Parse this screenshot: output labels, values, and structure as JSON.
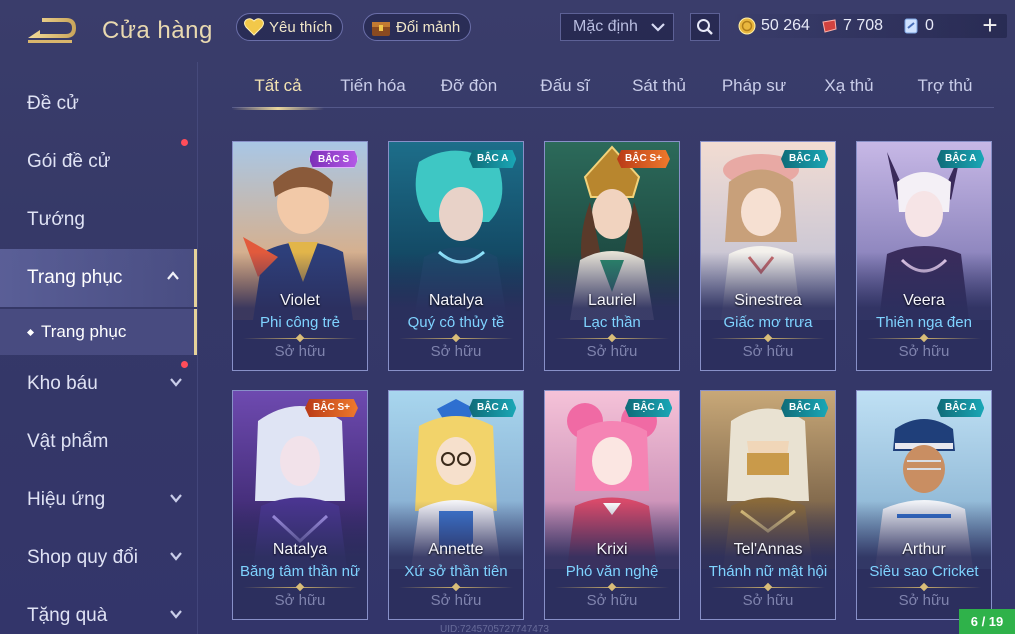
{
  "header": {
    "title": "Cửa hàng",
    "favorites_label": "Yêu thích",
    "exchange_label": "Đổi mảnh",
    "sort_value": "Mặc định",
    "currencies": [
      {
        "icon": "gold-coin-icon",
        "value": "50 264"
      },
      {
        "icon": "ruby-icon",
        "value": "7 708"
      },
      {
        "icon": "voucher-icon",
        "value": "0"
      }
    ],
    "plus_label": "+"
  },
  "sidebar": {
    "items": [
      {
        "label": "Đề cử"
      },
      {
        "label": "Gói đề cử"
      },
      {
        "label": "Tướng"
      },
      {
        "label": "Trang phục"
      },
      {
        "label": "Kho báu"
      },
      {
        "label": "Vật phẩm"
      },
      {
        "label": "Hiệu ứng"
      },
      {
        "label": "Shop quy đổi"
      },
      {
        "label": "Tặng quà"
      }
    ],
    "sub_item": "Trang phục"
  },
  "tabs": [
    "Tất cả",
    "Tiến hóa",
    "Đỡ đòn",
    "Đấu sĩ",
    "Sát thủ",
    "Pháp sư",
    "Xạ thủ",
    "Trợ thủ"
  ],
  "cards": [
    {
      "hero": "Violet",
      "skin": "Phi công trẻ",
      "status": "Sở hữu",
      "tier": "BẬC S"
    },
    {
      "hero": "Natalya",
      "skin": "Quý cô thủy tề",
      "status": "Sở hữu",
      "tier": "BẬC A"
    },
    {
      "hero": "Lauriel",
      "skin": "Lạc thần",
      "status": "Sở hữu",
      "tier": "BẬC S+"
    },
    {
      "hero": "Sinestrea",
      "skin": "Giấc mơ trưa",
      "status": "Sở hữu",
      "tier": "BẬC A"
    },
    {
      "hero": "Veera",
      "skin": "Thiên nga đen",
      "status": "Sở hữu",
      "tier": "BẬC A"
    },
    {
      "hero": "Natalya",
      "skin": "Băng tâm thần nữ",
      "status": "Sở hữu",
      "tier": "BẬC S+"
    },
    {
      "hero": "Annette",
      "skin": "Xứ sở thần tiên",
      "status": "Sở hữu",
      "tier": "BẬC A"
    },
    {
      "hero": "Krixi",
      "skin": "Phó văn nghệ",
      "status": "Sở hữu",
      "tier": "BẬC A"
    },
    {
      "hero": "Tel'Annas",
      "skin": "Thánh nữ mật hội",
      "status": "Sở hữu",
      "tier": "BẬC A"
    },
    {
      "hero": "Arthur",
      "skin": "Siêu sao Cricket",
      "status": "Sở hữu",
      "tier": "BẬC A"
    }
  ],
  "pagination": "6 / 19",
  "uid_text": "UID:7245705727747473",
  "colors": {
    "accent_gold": "#e9d59c",
    "skin_name": "#7fd3ff",
    "page_indicator": "#2fb24a",
    "notification": "#ff4d5a"
  }
}
